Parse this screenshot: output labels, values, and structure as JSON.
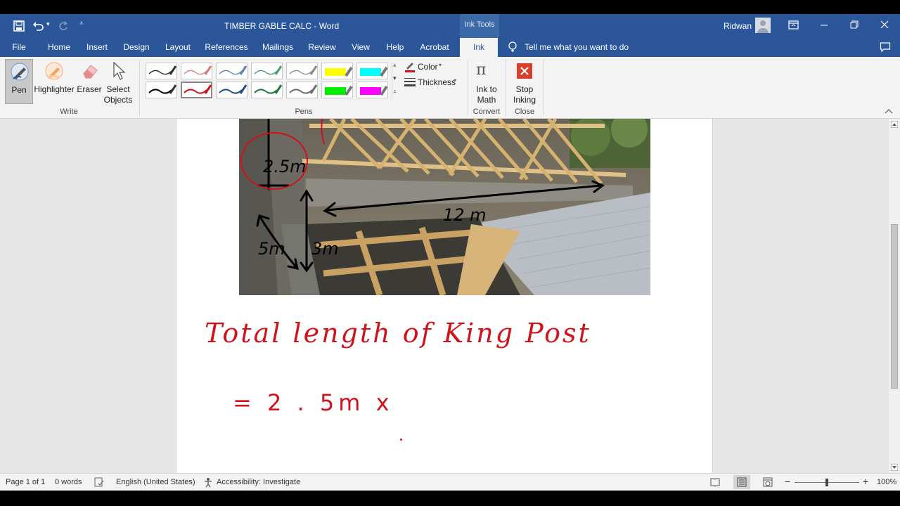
{
  "title_bar": {
    "document_title": "TIMBER GABLE CALC  -  Word",
    "contextual_group": "Ink Tools",
    "user_name": "Ridwan",
    "icons": [
      "save-icon",
      "undo-icon",
      "redo-icon",
      "customize-qat-icon",
      "ribbon-display-icon",
      "minimize-icon",
      "restore-icon",
      "close-icon"
    ]
  },
  "tabs": {
    "file": "File",
    "home": "Home",
    "insert": "Insert",
    "design": "Design",
    "layout": "Layout",
    "references": "References",
    "mailings": "Mailings",
    "review": "Review",
    "view": "View",
    "help": "Help",
    "acrobat": "Acrobat",
    "ink": "Ink",
    "tell_me": "Tell me what you want to do"
  },
  "ribbon": {
    "write": {
      "pen": "Pen",
      "highlighter": "Highlighter",
      "eraser": "Eraser",
      "select_line1": "Select",
      "select_line2": "Objects",
      "group": "Write"
    },
    "pens": {
      "group": "Pens",
      "color": "Color",
      "thickness": "Thickness",
      "row1": [
        "#222222",
        "#d4797f",
        "#5f7fb0",
        "#4f9a6c",
        "#8a8a8a",
        "#ffff00",
        "#00ffff"
      ],
      "row2": [
        "#000000",
        "#d0121b",
        "#1f4e8c",
        "#1b7a3c",
        "#6d6d6d",
        "#00ee00",
        "#ff00ff"
      ]
    },
    "convert": {
      "ink_to_math_line1": "Ink to",
      "ink_to_math_line2": "Math",
      "group": "Convert"
    },
    "close": {
      "stop_line1": "Stop",
      "stop_line2": "Inking",
      "group": "Close"
    }
  },
  "document": {
    "photo_annotations": {
      "height_label": "2.5m",
      "length_label": "12 m",
      "side_label": "5m",
      "wall_label": "3m"
    },
    "handwriting_line1": "Total length of King Post",
    "handwriting_line2": "= 2 . 5m x"
  },
  "status": {
    "page": "Page 1 of 1",
    "words": "0 words",
    "language": "English (United States)",
    "accessibility": "Accessibility: Investigate",
    "zoom_minus": "−",
    "zoom_plus": "+",
    "zoom_level": "100%",
    "zoom_fraction": 0.5
  },
  "colors": {
    "brand_blue": "#2b579a",
    "ink_red": "#d0121b",
    "stop_inking_red": "#d9402b"
  }
}
